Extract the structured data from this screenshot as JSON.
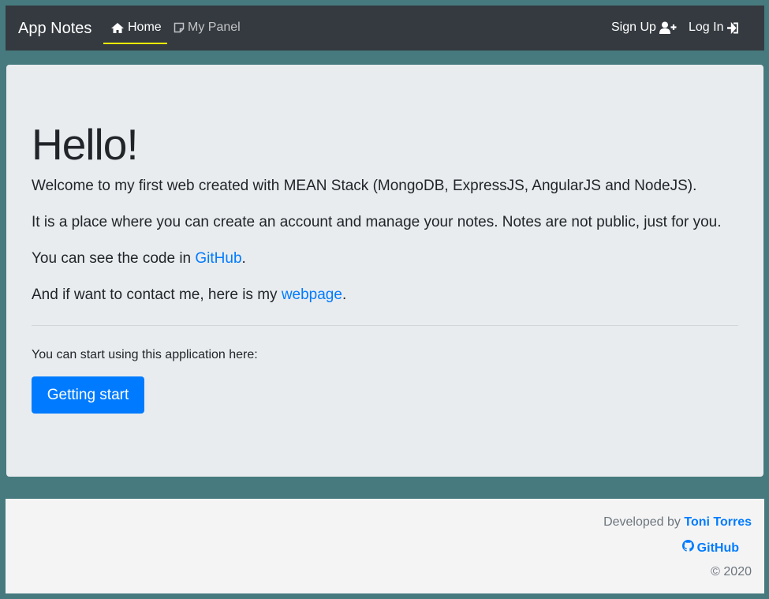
{
  "navbar": {
    "brand": "App Notes",
    "links": {
      "home": "Home",
      "panel": "My Panel",
      "signup": "Sign Up",
      "login": "Log In"
    },
    "colors": {
      "background": "#343a40",
      "active_underline": "#ffee00"
    },
    "icons": {
      "home": "home-icon",
      "panel": "sticky-note-icon",
      "signup": "user-plus-icon",
      "login": "sign-in-icon"
    }
  },
  "jumbotron": {
    "title": "Hello!",
    "intro_prefix": "Welcome to my first web created with ",
    "intro_mean": "MEAN",
    "intro_suffix": " Stack (MongoDB, ExpressJS, AngularJS and NodeJS).",
    "description": "It is a place where you can create an account and manage your notes. Notes are not public, just for you.",
    "code_prefix": "You can see the code in ",
    "code_link": "GitHub",
    "code_suffix": ".",
    "contact_prefix": "And if want to contact me, here is my ",
    "contact_link": "webpage",
    "contact_suffix": ".",
    "start_text": "You can start using this application here:",
    "start_button": "Getting start"
  },
  "footer": {
    "developed_by": "Developed by ",
    "author": "Toni Torres",
    "github": "GitHub",
    "github_icon": "github-icon",
    "copyright": "© 2020"
  },
  "colors": {
    "page_background": "#467a7e",
    "accent": "#007bff"
  }
}
